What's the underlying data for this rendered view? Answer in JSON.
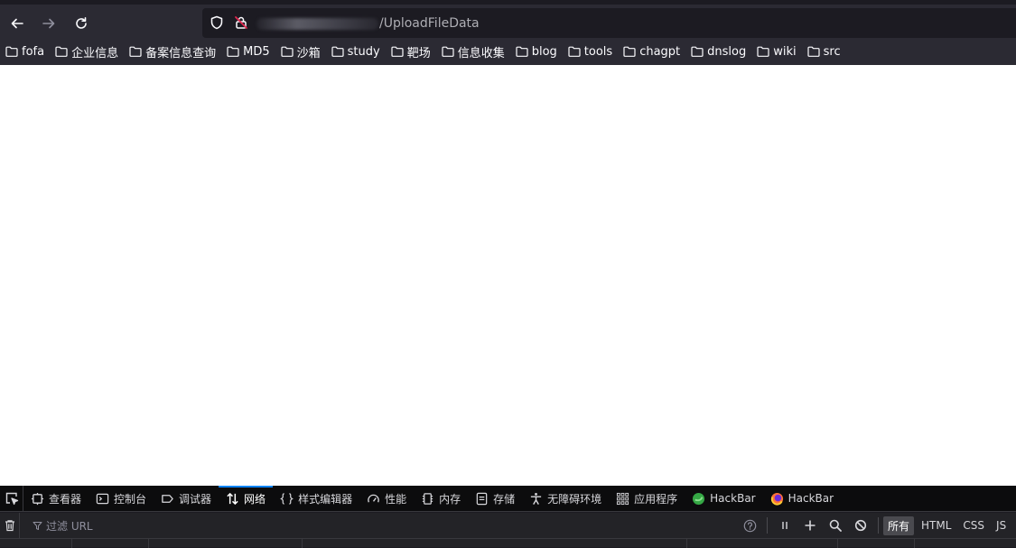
{
  "nav": {
    "back_icon": "arrow-left-icon",
    "forward_icon": "arrow-right-icon",
    "reload_icon": "reload-icon"
  },
  "urlbar": {
    "path": "/UploadFileData",
    "shield_icon": "tracking-protection-shield-icon",
    "lock_icon": "insecure-lock-icon"
  },
  "bookmarks": [
    {
      "label": "fofa"
    },
    {
      "label": "企业信息"
    },
    {
      "label": "备案信息查询"
    },
    {
      "label": "MD5"
    },
    {
      "label": "沙箱"
    },
    {
      "label": "study"
    },
    {
      "label": "靶场"
    },
    {
      "label": "信息收集"
    },
    {
      "label": "blog"
    },
    {
      "label": "tools"
    },
    {
      "label": "chagpt"
    },
    {
      "label": "dnslog"
    },
    {
      "label": "wiki"
    },
    {
      "label": "src"
    }
  ],
  "devtools": {
    "tabs": [
      {
        "label": "查看器",
        "icon": "inspector-icon"
      },
      {
        "label": "控制台",
        "icon": "console-icon"
      },
      {
        "label": "调试器",
        "icon": "debugger-icon"
      },
      {
        "label": "网络",
        "icon": "network-icon",
        "active": true
      },
      {
        "label": "样式编辑器",
        "icon": "style-editor-icon"
      },
      {
        "label": "性能",
        "icon": "performance-icon"
      },
      {
        "label": "内存",
        "icon": "memory-icon"
      },
      {
        "label": "存储",
        "icon": "storage-icon"
      },
      {
        "label": "无障碍环境",
        "icon": "accessibility-icon"
      },
      {
        "label": "应用程序",
        "icon": "application-icon"
      },
      {
        "label": "HackBar",
        "icon": "hackbar-green-icon"
      },
      {
        "label": "HackBar",
        "icon": "hackbar-orange-icon"
      }
    ],
    "filter_placeholder": "过滤 URL",
    "type_filters": [
      {
        "label": "所有",
        "active": true
      },
      {
        "label": "HTML"
      },
      {
        "label": "CSS"
      },
      {
        "label": "JS"
      }
    ]
  },
  "colors": {
    "accent": "#0a84ff",
    "toolbar_bg": "#2b2a33",
    "devtools_bg": "#0c0c0d"
  }
}
